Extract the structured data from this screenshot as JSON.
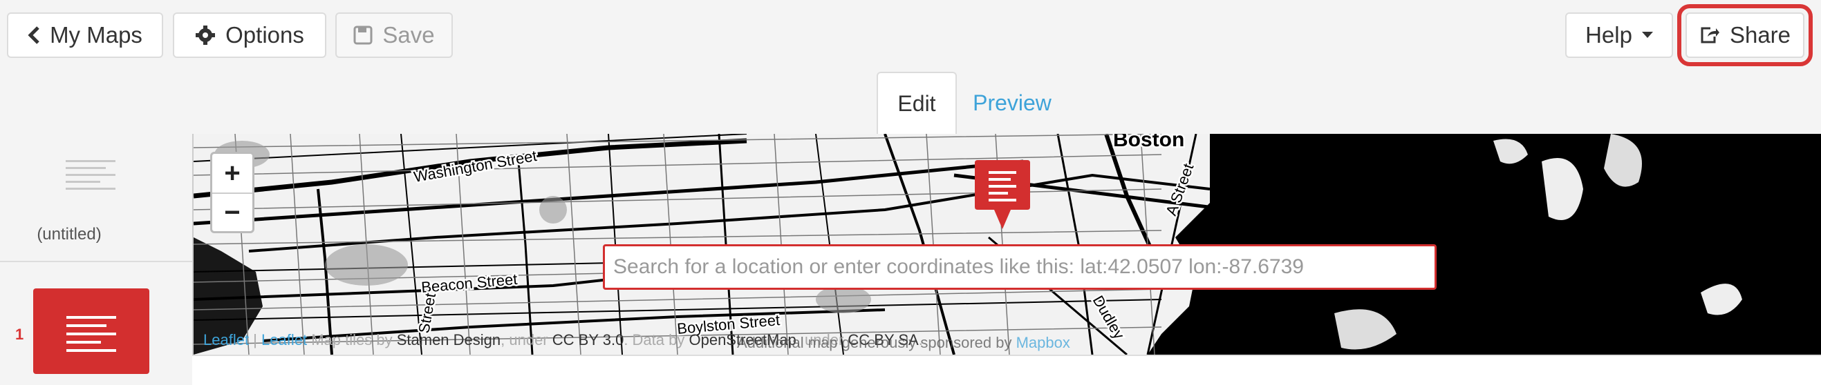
{
  "toolbar": {
    "my_maps": "My Maps",
    "options": "Options",
    "save": "Save",
    "help": "Help",
    "share": "Share"
  },
  "tabs": {
    "edit": "Edit",
    "preview": "Preview"
  },
  "sidebar": {
    "slides": [
      {
        "label": "(untitled)"
      },
      {
        "number": "1"
      }
    ]
  },
  "map": {
    "zoom_in": "+",
    "zoom_out": "−",
    "search_placeholder": "Search for a location or enter coordinates like this: lat:42.0507 lon:-87.6739",
    "street_labels": [
      "Washington Street",
      "Beacon Street",
      "Boylston Street",
      "Boston",
      "A Street",
      "Dudley",
      "Street"
    ],
    "attribution": {
      "leaflet1": "Leaflet",
      "leaflet2": "Leaflet",
      "tiles_prefix": "Map tiles by",
      "stamen": "Stamen Design",
      "under1": ", under",
      "ccby": "CC BY 3.0",
      "data_by": ". Data by",
      "osm": "OpenStreetMap",
      "under2": ", under",
      "ccbysa": "CC BY SA",
      "dot": "."
    },
    "sponsor_text": "Additional map generously sponsored by",
    "sponsor_link": "Mapbox"
  },
  "colors": {
    "accent": "#d32f2f",
    "link": "#3ea3d9",
    "highlight": "#d93636"
  }
}
